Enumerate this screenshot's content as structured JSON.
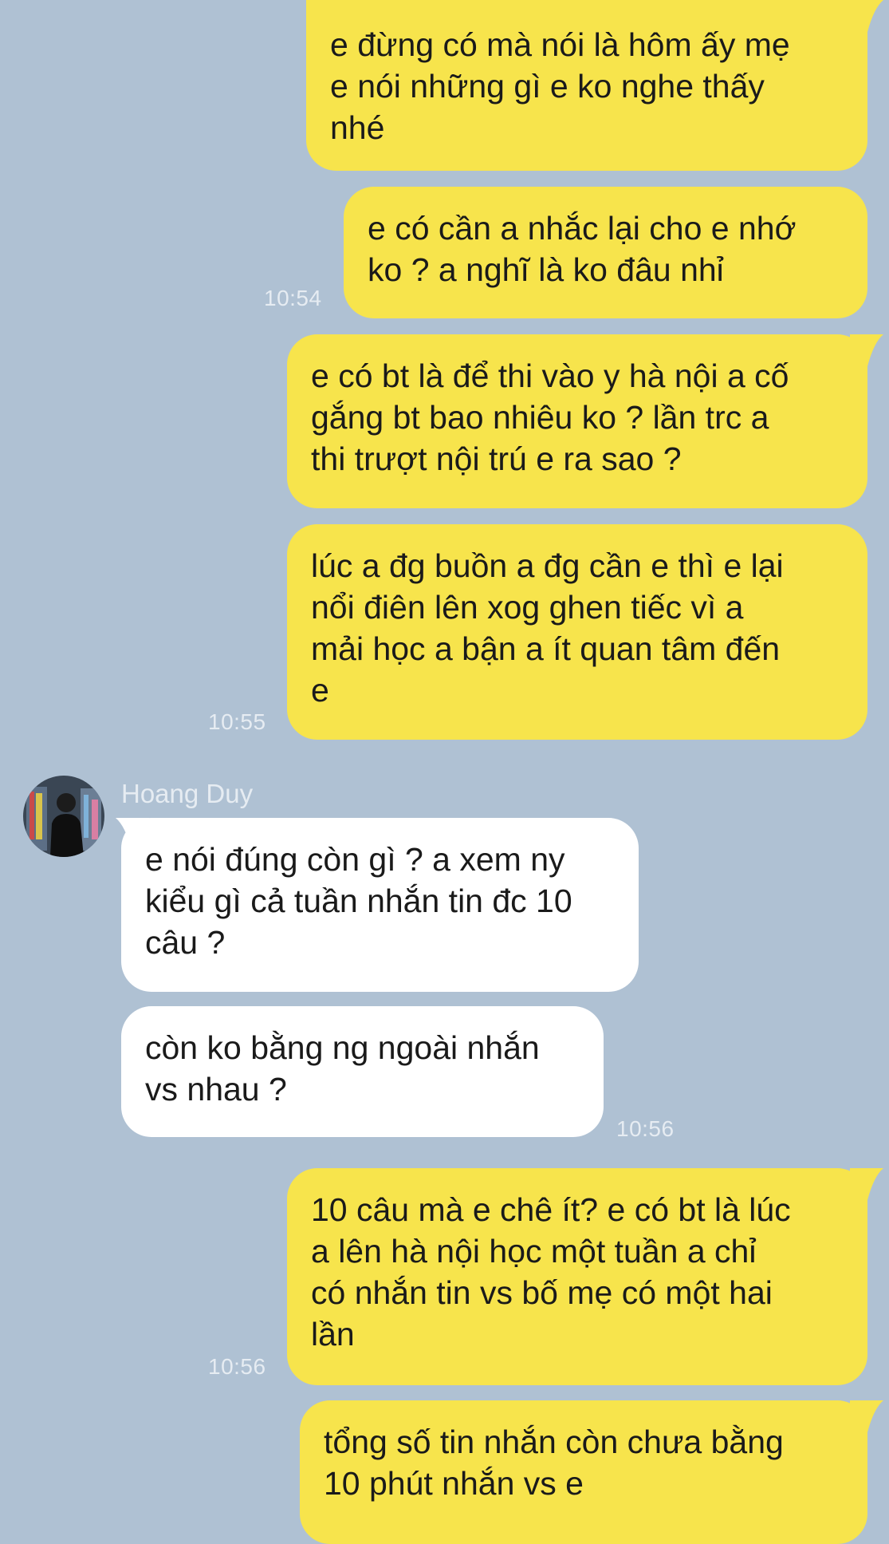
{
  "colors": {
    "background": "#afc1d3",
    "my_bubble": "#f7e44c",
    "their_bubble": "#ffffff",
    "timestamp": "#e6ecf2"
  },
  "contact": {
    "name": "Hoang Duy",
    "avatar_icon": "person-photo-avatar"
  },
  "messages": [
    {
      "sender": "me",
      "text": "e đừng có mà nói là hôm ấy mẹ\ne nói những gì e ko nghe thấy\nnhé"
    },
    {
      "sender": "me",
      "text": "e có cần a nhắc lại cho e nhớ\nko ? a nghĩ là ko đâu nhỉ",
      "time": "10:54"
    },
    {
      "sender": "me",
      "text": "e có bt là để thi vào y hà nội a cố\ngắng bt bao nhiêu ko ? lần trc a\nthi trượt nội trú e ra sao ?"
    },
    {
      "sender": "me",
      "text": "lúc a đg buồn a đg cần e thì e lại\nnổi điên lên xog ghen tiếc vì a\nmải học a bận a ít quan tâm đến\ne",
      "time": "10:55"
    },
    {
      "sender": "them",
      "text": "e nói đúng còn gì ? a xem ny\nkiểu gì cả tuần nhắn tin đc 10\ncâu ?"
    },
    {
      "sender": "them",
      "text": "còn ko bằng ng ngoài nhắn\nvs nhau ?",
      "time": "10:56"
    },
    {
      "sender": "me",
      "text": "10 câu mà e chê ít? e có bt là lúc\na lên hà nội học một tuần a chỉ\ncó nhắn tin vs bố mẹ có một hai\nlần",
      "time": "10:56"
    },
    {
      "sender": "me",
      "text": "tổng số tin nhắn còn chưa bằng\n10 phút nhắn vs e"
    }
  ]
}
